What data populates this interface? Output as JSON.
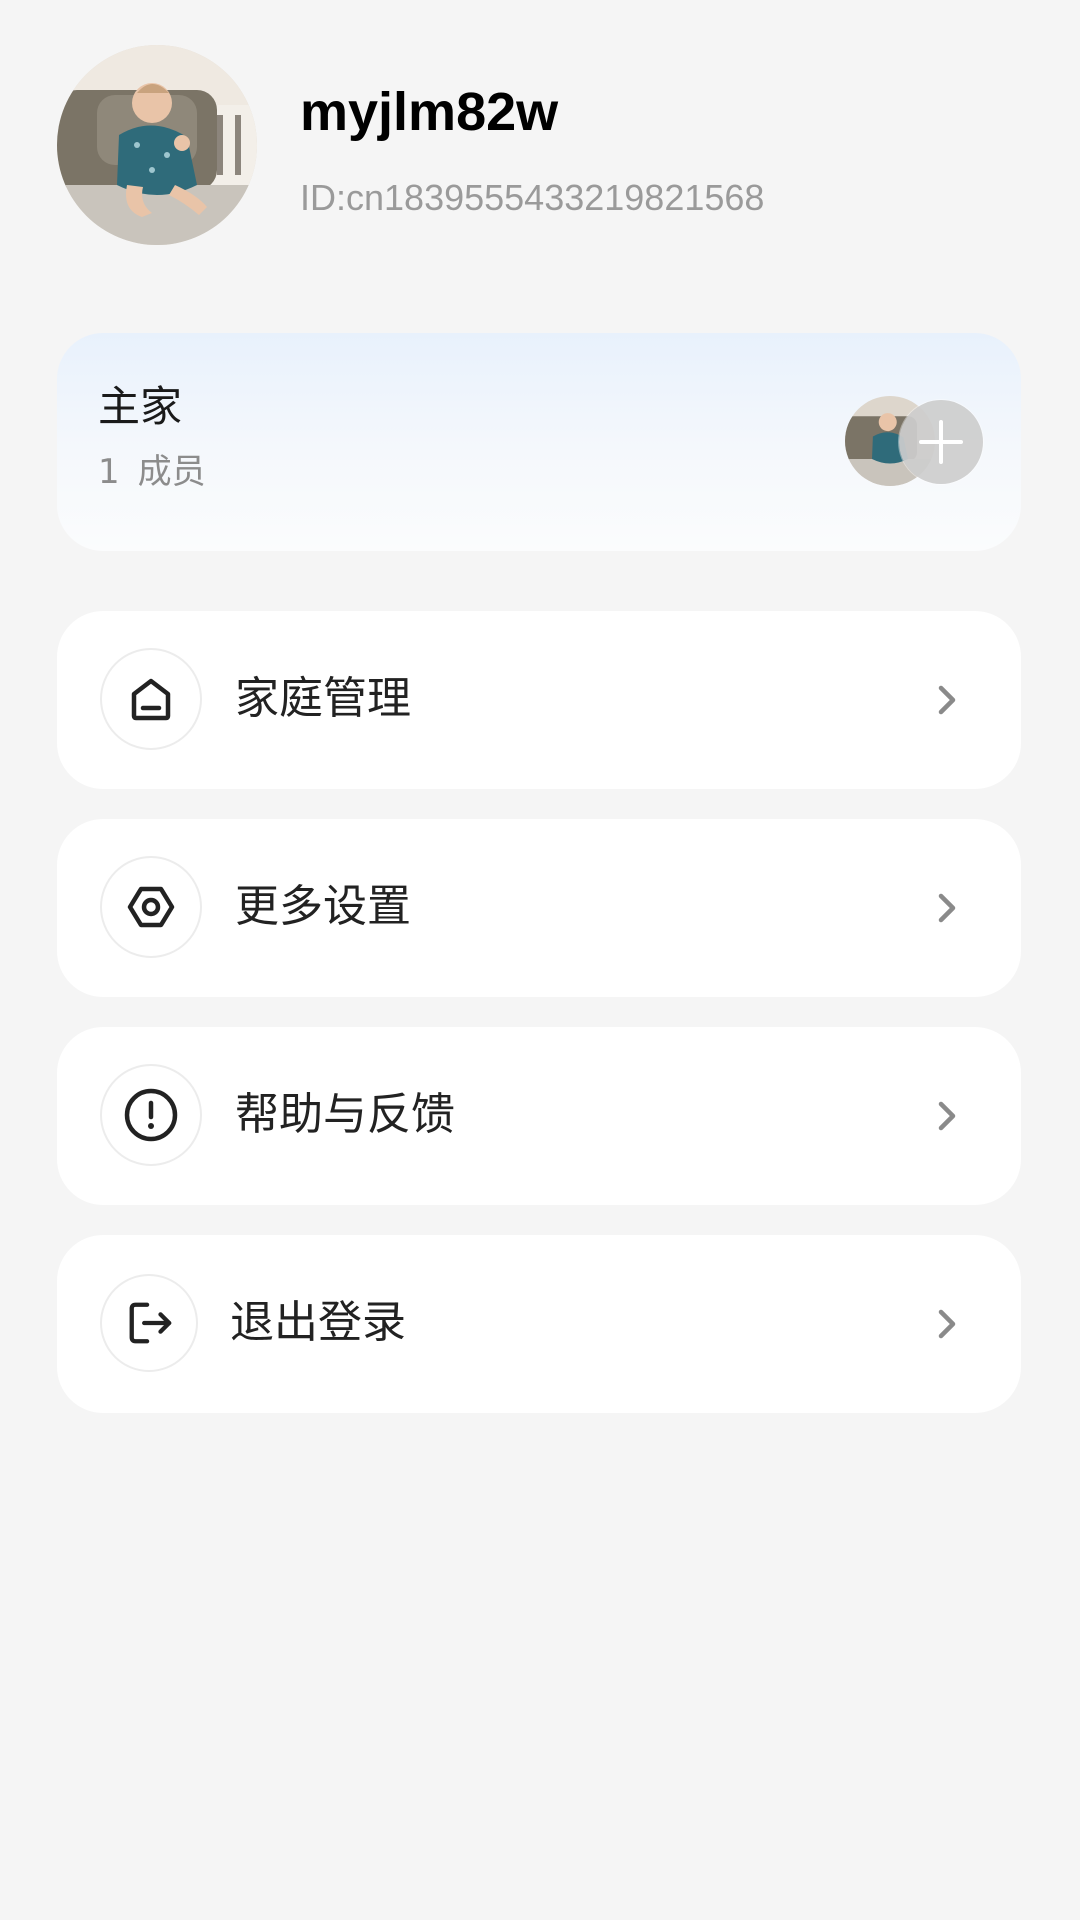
{
  "profile": {
    "username": "myjlm82w",
    "user_id": "ID:cn1839555433219821568"
  },
  "home": {
    "name": "主家",
    "member_count": "1",
    "member_label": "成员"
  },
  "menu": {
    "items": [
      {
        "label": "家庭管理",
        "icon": "home-icon"
      },
      {
        "label": "更多设置",
        "icon": "hexagon-settings-icon"
      },
      {
        "label": "帮助与反馈",
        "icon": "exclamation-circle-icon"
      },
      {
        "label": "退出登录",
        "icon": "logout-icon"
      }
    ]
  },
  "colors": {
    "background": "#f5f5f5",
    "card": "#ffffff",
    "home_card_gradient_top": "#e8f1fc",
    "secondary_text": "#9a9a9a"
  }
}
